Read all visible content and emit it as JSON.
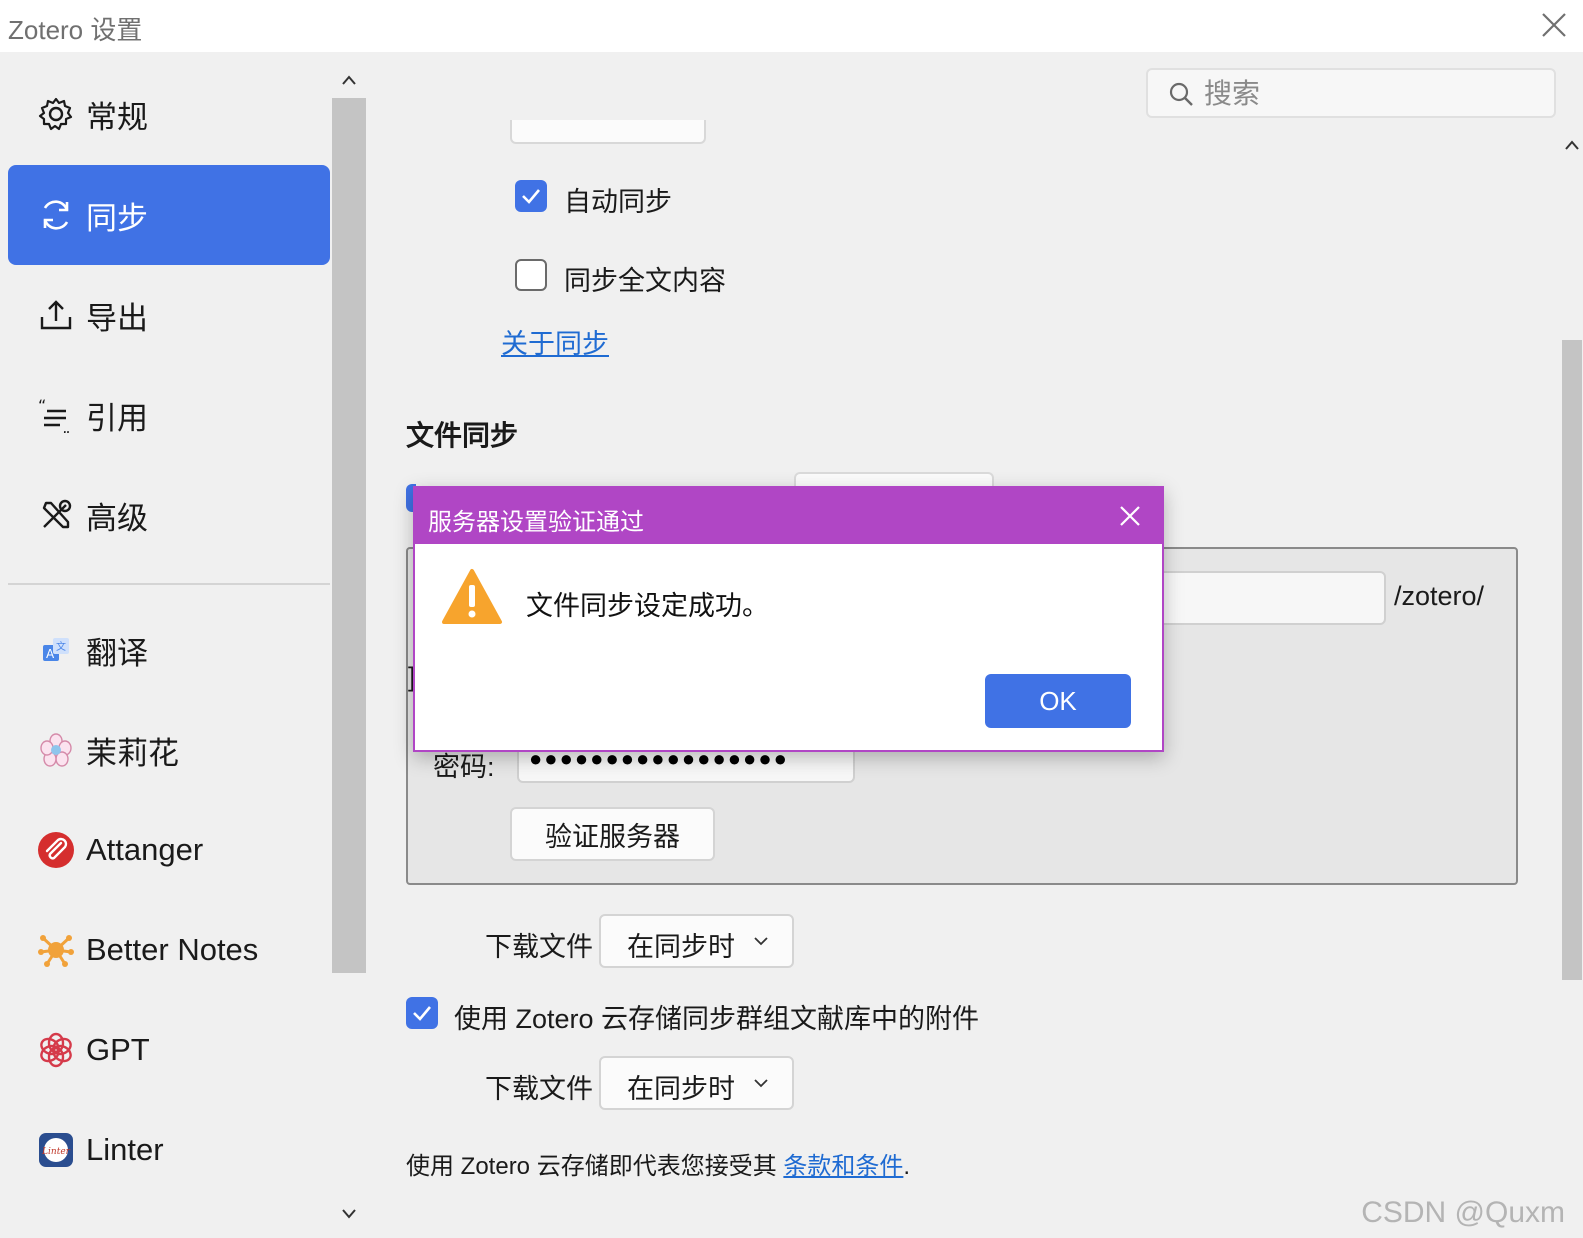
{
  "window": {
    "title": "Zotero 设置"
  },
  "sidebar": {
    "items": [
      {
        "label": "常规",
        "icon": "gear-icon"
      },
      {
        "label": "同步",
        "icon": "sync-icon",
        "active": true
      },
      {
        "label": "导出",
        "icon": "export-icon"
      },
      {
        "label": "引用",
        "icon": "cite-icon"
      },
      {
        "label": "高级",
        "icon": "advanced-tools-icon"
      }
    ],
    "plugins": [
      {
        "label": "翻译",
        "icon": "translate-icon"
      },
      {
        "label": "茉莉花",
        "icon": "jasmine-icon"
      },
      {
        "label": "Attanger",
        "icon": "attanger-icon"
      },
      {
        "label": "Better Notes",
        "icon": "better-notes-icon"
      },
      {
        "label": "GPT",
        "icon": "gpt-icon"
      },
      {
        "label": "Linter",
        "icon": "linter-icon"
      }
    ]
  },
  "search": {
    "placeholder": "搜索"
  },
  "sync": {
    "auto_sync_label": "自动同步",
    "auto_sync_checked": true,
    "fulltext_label": "同步全文内容",
    "fulltext_checked": false,
    "about_link": "关于同步"
  },
  "file_sync": {
    "section_title": "文件同步",
    "url_suffix": "/zotero/",
    "fragment_char": "]",
    "password_label": "密码:",
    "password_value": "●●●●●●●●●●●●●●●●●",
    "verify_button": "验证服务器",
    "download_label": "下载文件",
    "download_value": "在同步时",
    "group_checkbox_label": "使用 Zotero 云存储同步群组文献库中的附件",
    "group_checked": true,
    "group_download_label": "下载文件",
    "group_download_value": "在同步时",
    "terms_prefix": "使用 Zotero 云存储即代表您接受其 ",
    "terms_link": "条款和条件",
    "terms_suffix": "."
  },
  "dialog": {
    "title": "服务器设置验证通过",
    "message": "文件同步设定成功。",
    "ok_label": "OK",
    "icon": "warning-icon"
  },
  "watermark": "CSDN @Quxm",
  "colors": {
    "accent": "#4072e5",
    "dialog_title": "#b046c5",
    "warning": "#f7a42d",
    "link": "#1f6bd2"
  }
}
